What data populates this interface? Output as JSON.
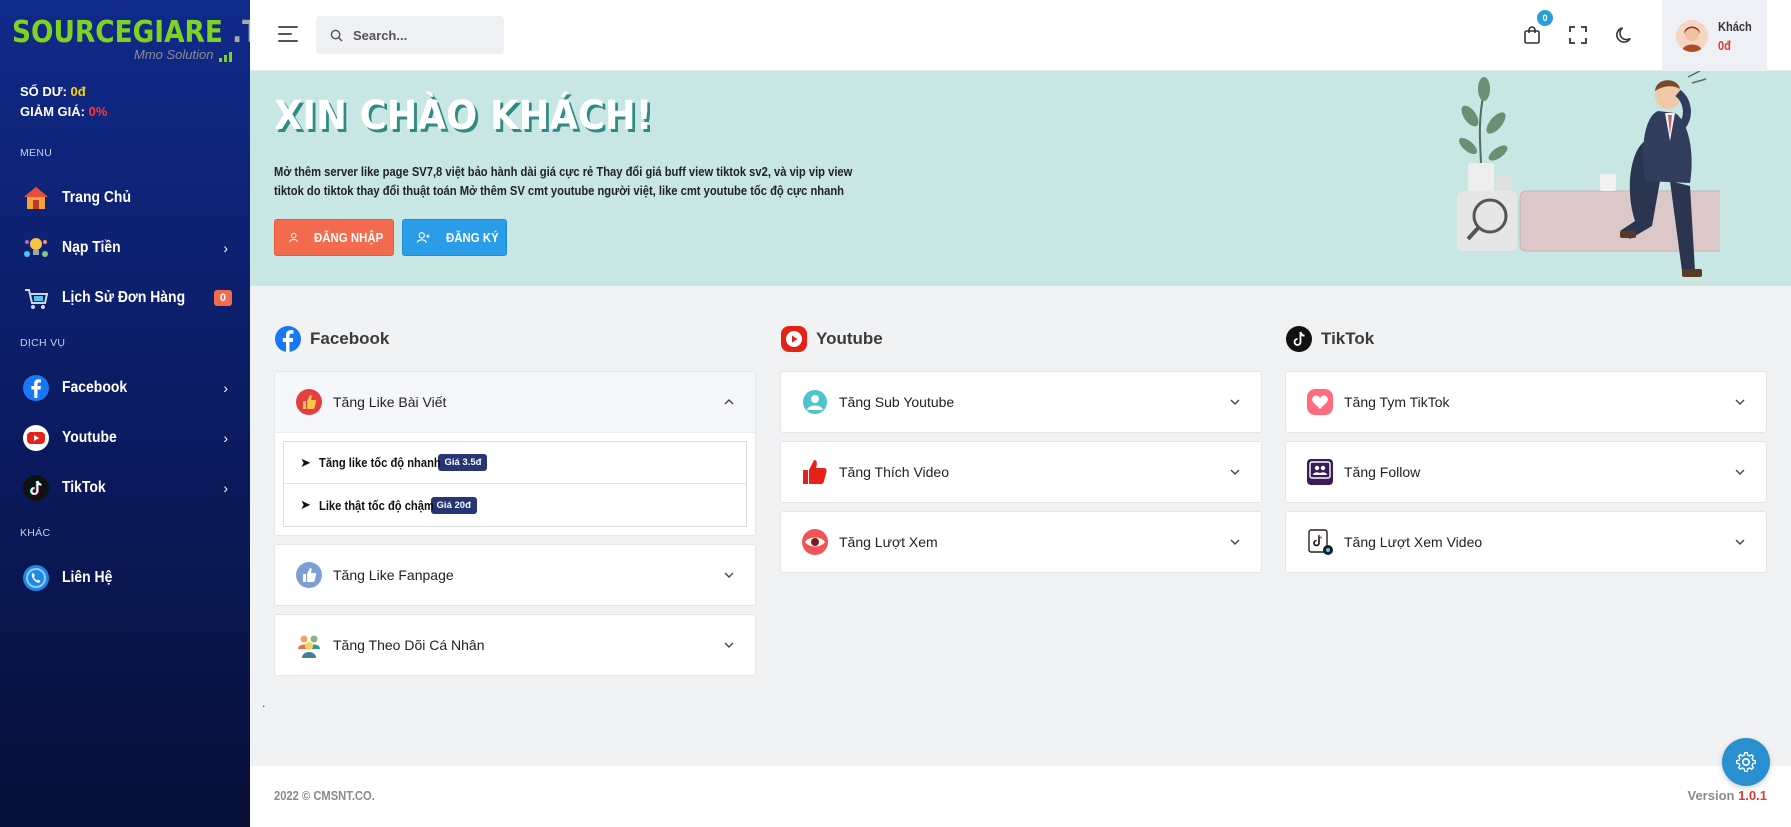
{
  "brand": {
    "logo_main": "SOURCEGIARE",
    "logo_suffix": ".TK",
    "logo_sub": "Mmo Solution"
  },
  "account": {
    "balance_label": "SỐ DƯ:",
    "balance_value": "0đ",
    "discount_label": "GIẢM GIÁ:",
    "discount_value": "0%"
  },
  "sidebar": {
    "section_menu": "MENU",
    "section_services": "DỊCH VỤ",
    "section_other": "KHÁC",
    "items": [
      {
        "label": "Trang Chủ",
        "icon": "home-icon"
      },
      {
        "label": "Nạp Tiền",
        "icon": "deposit-icon"
      },
      {
        "label": "Lịch Sử Đơn Hàng",
        "icon": "cart-history-icon",
        "badge": "0"
      },
      {
        "label": "Facebook",
        "icon": "facebook-icon"
      },
      {
        "label": "Youtube",
        "icon": "youtube-icon"
      },
      {
        "label": "TikTok",
        "icon": "tiktok-icon"
      },
      {
        "label": "Liên Hệ",
        "icon": "contact-icon"
      }
    ]
  },
  "topbar": {
    "search_placeholder": "Search...",
    "cart_count": "0",
    "user_name": "Khách",
    "user_money": "0đ"
  },
  "banner": {
    "title": "XIN CHÀO KHÁCH!",
    "description": "Mở thêm server like page SV7,8 việt bảo hành dài giá cực rẻ Thay đổi giá buff view tiktok sv2, và vip vip view tiktok do tiktok thay đổi thuật toán Mở thêm SV cmt youtube người việt, like cmt youtube tốc độ cực nhanh",
    "login_label": "ĐĂNG NHẬP",
    "register_label": "ĐĂNG KÝ"
  },
  "columns": {
    "facebook": {
      "title": "Facebook",
      "cards": [
        {
          "label": "Tăng Like Bài Viết",
          "sub": [
            {
              "text": "Tăng like tốc độ nhanh",
              "price": "Giá 3.5đ"
            },
            {
              "text": "Like thật tốc độ chậm",
              "price": "Giá 20đ"
            }
          ]
        },
        {
          "label": "Tăng Like Fanpage"
        },
        {
          "label": "Tăng Theo Dõi Cá Nhân"
        }
      ]
    },
    "youtube": {
      "title": "Youtube",
      "cards": [
        {
          "label": "Tăng Sub Youtube"
        },
        {
          "label": "Tăng Thích Video"
        },
        {
          "label": "Tăng Lượt Xem"
        }
      ]
    },
    "tiktok": {
      "title": "TikTok",
      "cards": [
        {
          "label": "Tăng Tym TikTok"
        },
        {
          "label": "Tăng Follow"
        },
        {
          "label": "Tăng Lượt Xem Video"
        }
      ]
    }
  },
  "misc": {
    "dot": "."
  },
  "footer": {
    "copyright": "2022 © CMSNT.CO.",
    "version_label": "Version",
    "version_value": "1.0.1"
  },
  "colors": {
    "sidebar_top": "#102a8a",
    "sidebar_bottom": "#080f36",
    "brand_green": "#7ed321",
    "banner_bg": "#c8e6e4",
    "login_btn": "#f26b4f",
    "register_btn": "#2b9de8",
    "price_badge": "#253575"
  }
}
